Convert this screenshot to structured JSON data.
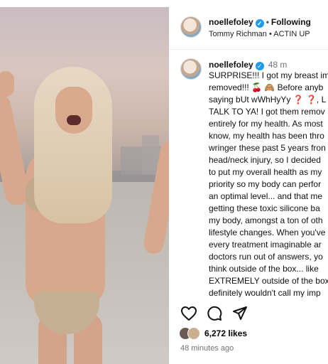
{
  "post": {
    "username": "noellefoley",
    "follow_status": "Following",
    "audio": "Tommy Richman • ACTIN UP",
    "caption_time": "48 m",
    "caption_lines": [
      "SURPRISE!!! I got my breast im",
      "removed!!! 🍒 🙈 Before anyb",
      "saying bUt wWhHyYy ❓ ❓, L",
      "TALK TO YA! I got them remov",
      "entirely for my health. As most",
      "know, my health has been thro",
      "wringer these past 5 years fron",
      "head/neck injury, so I decided",
      "to put my overall health as my",
      "priority so my body can perfor",
      "an optimal level... and that me",
      "getting these toxic silicone ba",
      "my body, amongst a ton of oth",
      "lifestyle changes. When you've",
      "every treatment imaginable ar",
      "doctors run out of answers, yo",
      "think outside of the box... like",
      "EXTREMELY outside of the box",
      "definitely wouldn't call my imp"
    ],
    "likes": "6,272 likes",
    "posted_ago": "48 minutes ago"
  },
  "icons": {
    "verified": "verified-badge-icon",
    "like": "heart-icon",
    "comment": "comment-icon",
    "share": "send-icon"
  },
  "colors": {
    "verified": "#1d9bf0",
    "muted": "#737373"
  }
}
